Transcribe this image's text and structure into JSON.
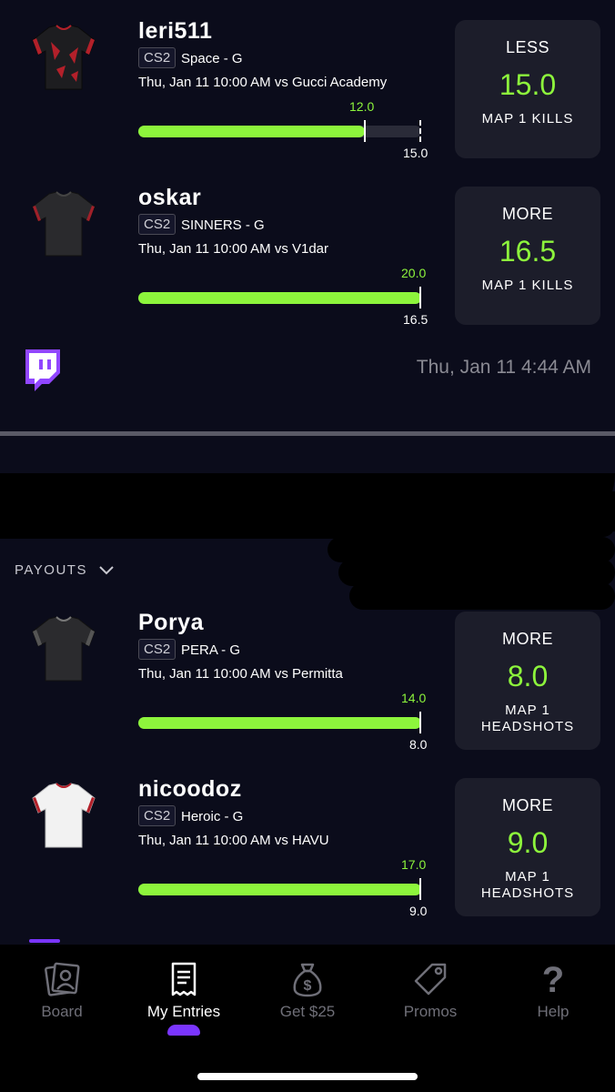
{
  "picks": [
    {
      "player": "leri511",
      "game_tag": "CS2",
      "team": "Space - G",
      "matchup": "Thu, Jan 11 10:00 AM  vs Gucci Academy",
      "actual": "12.0",
      "line": "15.0",
      "progress": 0.8,
      "direction": "LESS",
      "value": "15.0",
      "stat": "MAP 1 KILLS",
      "jersey": "jersey-black-red-icon"
    },
    {
      "player": "oskar",
      "game_tag": "CS2",
      "team": "SINNERS - G",
      "matchup": "Thu, Jan 11 10:00 AM  vs V1dar",
      "actual": "20.0",
      "line": "16.5",
      "progress": 1.0,
      "direction": "MORE",
      "value": "16.5",
      "stat": "MAP 1 KILLS",
      "jersey": "jersey-dark-gray-icon"
    },
    {
      "player": "Porya",
      "game_tag": "CS2",
      "team": "PERA - G",
      "matchup": "Thu, Jan 11 10:00 AM  vs Permitta",
      "actual": "14.0",
      "line": "8.0",
      "progress": 1.0,
      "direction": "MORE",
      "value": "8.0",
      "stat_line1": "MAP 1",
      "stat_line2": "HEADSHOTS",
      "jersey": "jersey-dark-gray-icon"
    },
    {
      "player": "nicoodoz",
      "game_tag": "CS2",
      "team": "Heroic - G",
      "matchup": "Thu, Jan 11 10:00 AM  vs HAVU",
      "actual": "17.0",
      "line": "9.0",
      "progress": 1.0,
      "direction": "MORE",
      "value": "9.0",
      "stat_line1": "MAP 1",
      "stat_line2": "HEADSHOTS",
      "jersey": "jersey-white-icon"
    }
  ],
  "entry": {
    "timestamp": "Thu, Jan 11 4:44 AM",
    "payouts_label": "PAYOUTS"
  },
  "nav": {
    "items": [
      {
        "label": "Board",
        "icon": "board-icon"
      },
      {
        "label": "My Entries",
        "icon": "entries-icon"
      },
      {
        "label": "Get $25",
        "icon": "money-bag-icon"
      },
      {
        "label": "Promos",
        "icon": "promo-tag-icon"
      },
      {
        "label": "Help",
        "icon": "help-icon"
      }
    ],
    "active": "My Entries"
  },
  "colors": {
    "background": "#0b0c1b",
    "card": "#1c1d2a",
    "accent_green": "#8df53c",
    "nav_active": "#7a35ff",
    "twitch": "#9146ff"
  }
}
